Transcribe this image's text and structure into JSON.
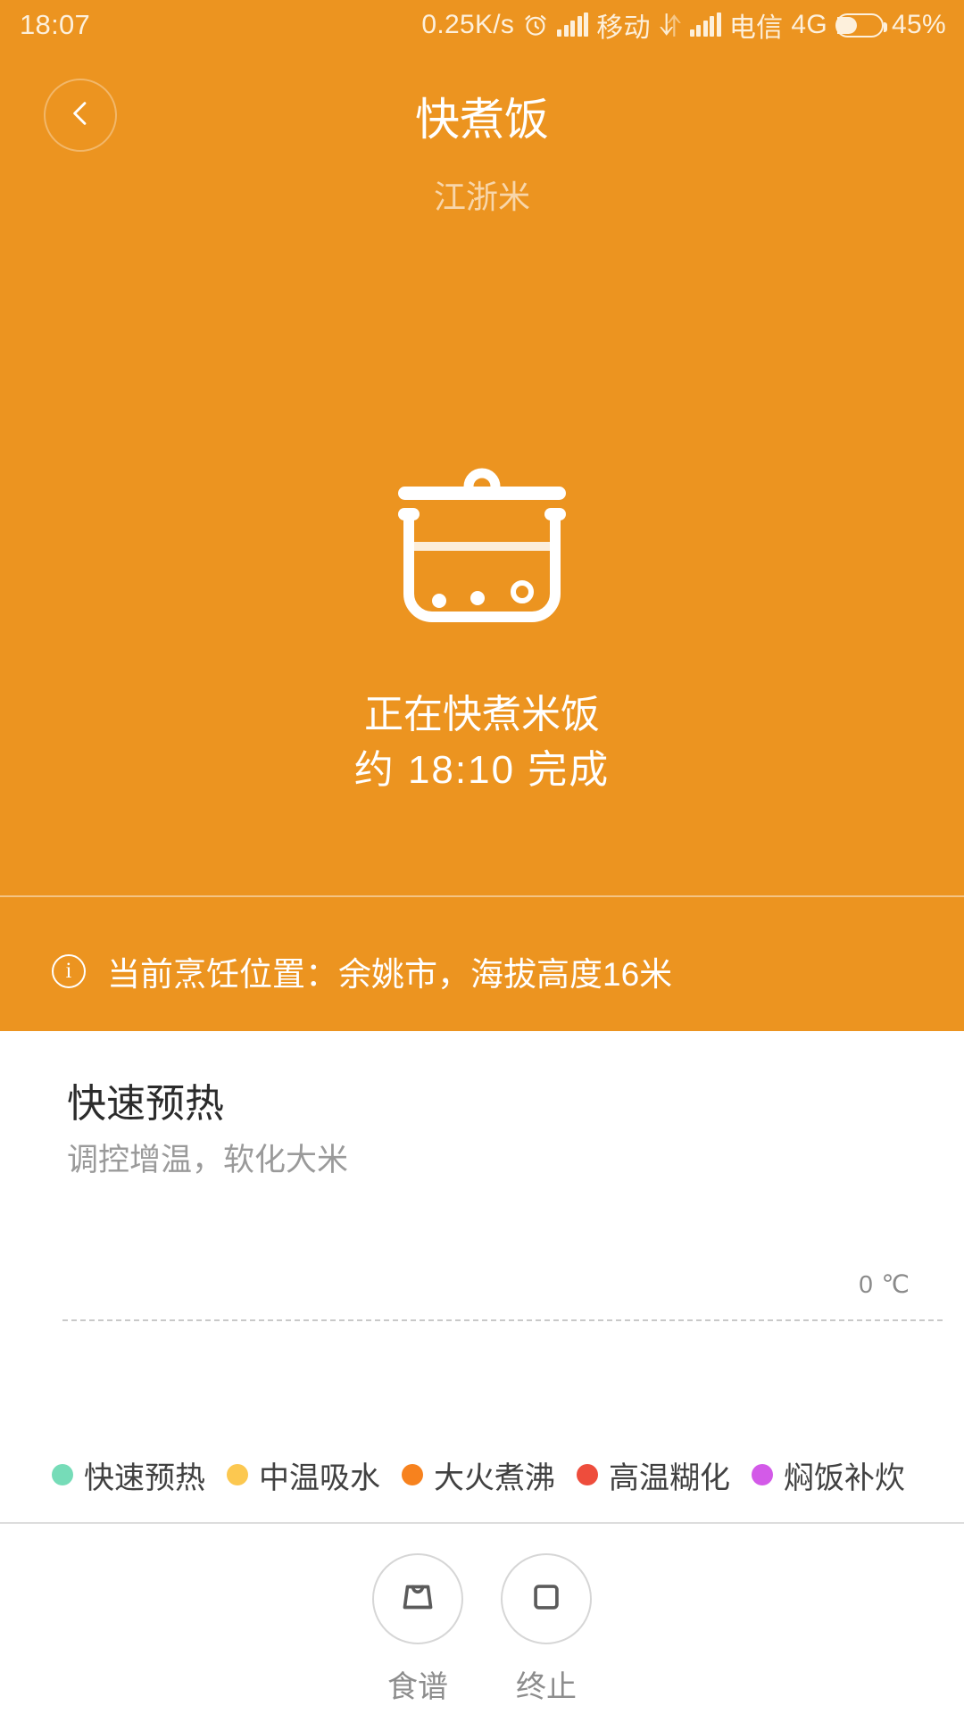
{
  "status_bar": {
    "clock": "18:07",
    "network_speed": "0.25K/s",
    "alarm_icon": "alarm-clock-icon",
    "carrier_1": "移动",
    "data_transfer_icon": "data-transfer-icon",
    "carrier_2": "电信",
    "network_type": "4G",
    "battery_percent": "45%",
    "battery_level": 45
  },
  "header": {
    "back_icon": "chevron-left-icon",
    "title": "快煮饭",
    "subtitle": "江浙米"
  },
  "cooking": {
    "appliance_icon": "rice-cooker-icon",
    "status_line": "正在快煮米饭",
    "finish_line": "约  18:10 完成",
    "finish_time": "18:10"
  },
  "info_bar": {
    "icon": "info-circle-icon",
    "text": "当前烹饪位置：余姚市，海拔高度16米",
    "city": "余姚市",
    "altitude": "16米"
  },
  "stage": {
    "name": "快速预热",
    "description": "调控增温，软化大米"
  },
  "chart_data": {
    "type": "line",
    "title": "",
    "xlabel": "",
    "ylabel": "",
    "axis_label": "0 ℃",
    "baseline_value": 0,
    "unit": "℃",
    "ylim": [
      0,
      0
    ],
    "grid": false,
    "series": [
      {
        "name": "快速预热",
        "color": "#76dcb8",
        "values": []
      },
      {
        "name": "中温吸水",
        "color": "#fcc850",
        "values": []
      },
      {
        "name": "大火煮沸",
        "color": "#f7821e",
        "values": []
      },
      {
        "name": "高温糊化",
        "color": "#ee4d3c",
        "values": []
      },
      {
        "name": "焖饭补炊",
        "color": "#d35ae8",
        "values": []
      }
    ],
    "legend_position": "bottom"
  },
  "legend": [
    {
      "label": "快速预热",
      "color": "#76dcb8"
    },
    {
      "label": "中温吸水",
      "color": "#fcc850"
    },
    {
      "label": "大火煮沸",
      "color": "#f7821e"
    },
    {
      "label": "高温糊化",
      "color": "#ee4d3c"
    },
    {
      "label": "焖饭补炊",
      "color": "#d35ae8"
    }
  ],
  "bottom_actions": [
    {
      "label": "食谱",
      "icon": "recipe-bag-icon"
    },
    {
      "label": "终止",
      "icon": "stop-square-icon"
    }
  ],
  "colors": {
    "brand_orange": "#ec9420",
    "text_on_orange": "#ffffff",
    "panel_background": "#ffffff"
  }
}
